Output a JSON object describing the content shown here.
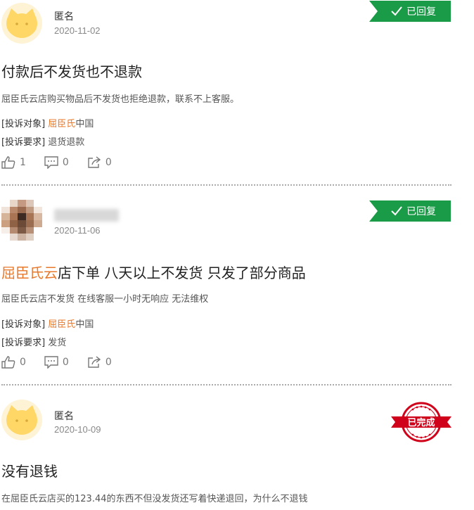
{
  "complaints": [
    {
      "user_name": "匿名",
      "date": "2020-11-02",
      "status": "已回复",
      "title": "付款后不发货也不退款",
      "title_highlight": "",
      "description": "屈臣氏云店购买物品后不发货也拒绝退款，联系不上客服。",
      "target_label": "[投诉对象]",
      "target_link": "屈臣氏",
      "target_suffix": "中国",
      "request_label": "[投诉要求]",
      "request_value": "退货退款",
      "likes": "1",
      "comments": "0",
      "shares": "0"
    },
    {
      "user_name": "",
      "date": "2020-11-06",
      "status": "已回复",
      "title_highlight": "屈臣氏云",
      "title": "店下单 八天以上不发货 只发了部分商品",
      "description": "屈臣氏云店不发货 在线客服一小时无响应 无法维权",
      "target_label": "[投诉对象]",
      "target_link": "屈臣氏",
      "target_suffix": "中国",
      "request_label": "[投诉要求]",
      "request_value": "发货",
      "likes": "0",
      "comments": "0",
      "shares": "0"
    },
    {
      "user_name": "匿名",
      "date": "2020-10-09",
      "status": "已完成",
      "title": "没有退钱",
      "description": "在屈臣氏云店买的123.44的东西不但没发货还写着快递退回，为什么不退钱"
    }
  ],
  "icons": {
    "like": "thumbs-up-icon",
    "comment": "comment-icon",
    "share": "share-icon",
    "check": "check-icon"
  },
  "colors": {
    "reply_badge": "#1a9b47",
    "highlight": "#e8782a",
    "stamp": "#d0021b"
  }
}
